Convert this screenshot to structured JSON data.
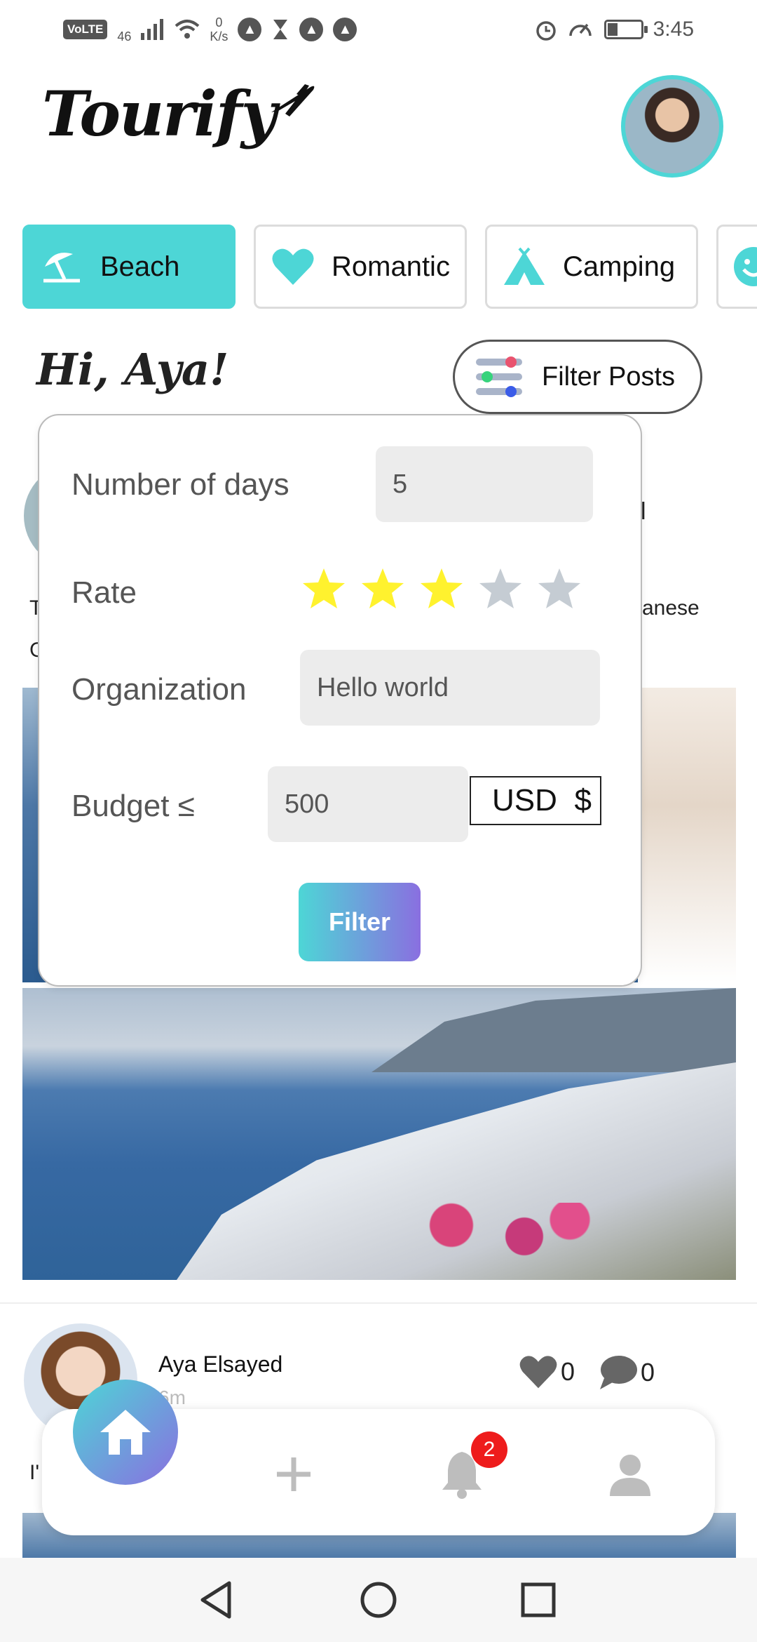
{
  "status_bar": {
    "volte": "VoLTE",
    "network": "46",
    "speed_value": "0",
    "speed_unit": "K/s",
    "time": "3:45",
    "battery_fraction": 0.3
  },
  "header": {
    "app_name": "Tourify"
  },
  "categories": [
    {
      "label": "Beach",
      "icon": "beach-umbrella-icon",
      "active": true
    },
    {
      "label": "Romantic",
      "icon": "heart-icon",
      "active": false
    },
    {
      "label": "Camping",
      "icon": "tent-icon",
      "active": false
    },
    {
      "label": "",
      "icon": "smile-icon",
      "active": false
    }
  ],
  "greeting": "Hi, Aya!",
  "filter_button_label": "Filter Posts",
  "filter_popup": {
    "days_label": "Number of days",
    "days_value": "5",
    "rate_label": "Rate",
    "rating": 3,
    "rating_max": 5,
    "organization_label": "Organization",
    "organization_value": "Hello world",
    "budget_label": "Budget ≤",
    "budget_value": "500",
    "currency": "USD",
    "currency_symbol": "$",
    "submit_label": "Filter"
  },
  "feed": {
    "post1_fragment_name": "l",
    "post1_fragment_text_left": "T",
    "post1_fragment_text_right": "anese",
    "post1_fragment_text_left2": "G",
    "post2": {
      "author": "Aya Elsayed",
      "time": "6m",
      "likes": "0",
      "comments": "0",
      "text_fragment": "I'"
    }
  },
  "bottom_nav": {
    "items": [
      "home-icon",
      "add-icon",
      "bell-icon",
      "profile-icon"
    ],
    "notifications_badge": "2"
  },
  "colors": {
    "accent": "#4dd6d6",
    "gradient_end": "#8a6fe0",
    "star_active": "#fff22e",
    "star_inactive": "#c5ccd3",
    "badge": "#ee1c1c"
  }
}
